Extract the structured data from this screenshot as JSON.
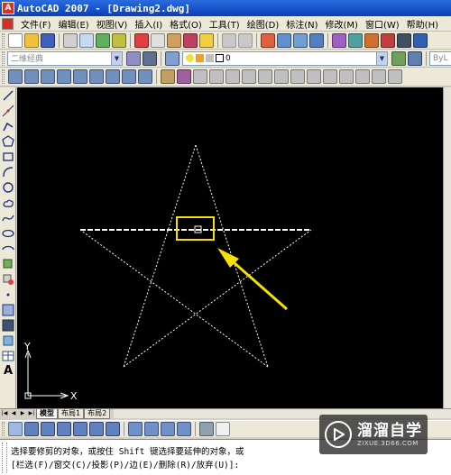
{
  "window": {
    "title": "AutoCAD 2007 - [Drawing2.dwg]",
    "app_icon_glyph": "A"
  },
  "menubar": {
    "items": [
      {
        "label": "文件(F)"
      },
      {
        "label": "编辑(E)"
      },
      {
        "label": "视图(V)"
      },
      {
        "label": "插入(I)"
      },
      {
        "label": "格式(O)"
      },
      {
        "label": "工具(T)"
      },
      {
        "label": "绘图(D)"
      },
      {
        "label": "标注(N)"
      },
      {
        "label": "修改(M)"
      },
      {
        "label": "窗口(W)"
      },
      {
        "label": "帮助(H)"
      }
    ]
  },
  "workspace": {
    "value": "二维经典"
  },
  "layer": {
    "value": "0"
  },
  "linetype": {
    "value": "ByL"
  },
  "layout_tabs": {
    "tabs": [
      {
        "label": "模型",
        "active": true
      },
      {
        "label": "布局1",
        "active": false
      },
      {
        "label": "布局2",
        "active": false
      }
    ]
  },
  "ucs": {
    "x_label": "X",
    "y_label": "Y"
  },
  "command_line": {
    "line1": "选择要修剪的对象，或按住 Shift 键选择要延伸的对象，或",
    "line2": "[栏选(F)/窗交(C)/投影(P)/边(E)/删除(R)/放弃(U)]:"
  },
  "watermark": {
    "name": "溜溜自学",
    "url": "ZIXUE.3D66.COM"
  },
  "colors": {
    "canvas": "#000000",
    "highlight_box": "#f5e000",
    "arrow": "#f5e000",
    "title_bar": "#0a3fb8",
    "chrome": "#ece9d8"
  }
}
